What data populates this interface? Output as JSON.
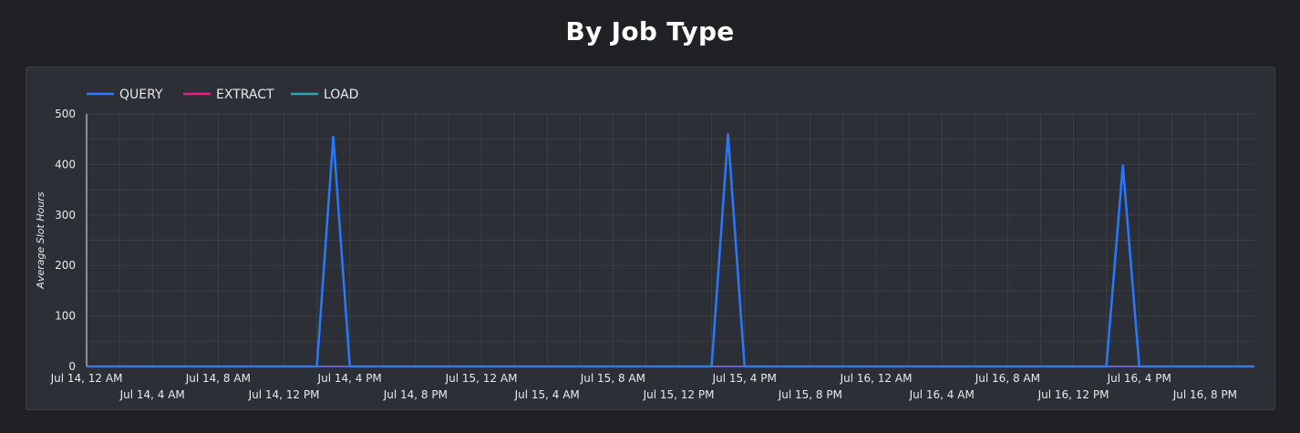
{
  "page": {
    "title": "By Job Type"
  },
  "colors": {
    "background": "#202124",
    "card": "#2d2f36",
    "grid": "#3c3f46",
    "QUERY": "#2979ff",
    "EXTRACT": "#e91e8c",
    "LOAD": "#26a7bd"
  },
  "chart_data": {
    "type": "line",
    "title": "By Job Type",
    "xlabel": "",
    "ylabel": "Average Slot Hours",
    "ylim": [
      0,
      500
    ],
    "yticks": [
      0,
      100,
      200,
      300,
      400,
      500
    ],
    "grid": true,
    "legend_position": "top-left",
    "x_unit": "hour",
    "x_start": "Jul 14, 12 AM",
    "x_end": "Jul 16, 11 PM",
    "xticks": [
      {
        "label": "Jul 14, 12 AM",
        "hour": 0
      },
      {
        "label": "Jul 14, 4 AM",
        "hour": 4
      },
      {
        "label": "Jul 14, 8 AM",
        "hour": 8
      },
      {
        "label": "Jul 14, 12 PM",
        "hour": 12
      },
      {
        "label": "Jul 14, 4 PM",
        "hour": 16
      },
      {
        "label": "Jul 14, 8 PM",
        "hour": 20
      },
      {
        "label": "Jul 15, 12 AM",
        "hour": 24
      },
      {
        "label": "Jul 15, 4 AM",
        "hour": 28
      },
      {
        "label": "Jul 15, 8 AM",
        "hour": 32
      },
      {
        "label": "Jul 15, 12 PM",
        "hour": 36
      },
      {
        "label": "Jul 15, 4 PM",
        "hour": 40
      },
      {
        "label": "Jul 15, 8 PM",
        "hour": 44
      },
      {
        "label": "Jul 16, 12 AM",
        "hour": 48
      },
      {
        "label": "Jul 16, 4 AM",
        "hour": 52
      },
      {
        "label": "Jul 16, 8 AM",
        "hour": 56
      },
      {
        "label": "Jul 16, 12 PM",
        "hour": 60
      },
      {
        "label": "Jul 16, 4 PM",
        "hour": 64
      },
      {
        "label": "Jul 16, 8 PM",
        "hour": 68
      }
    ],
    "series": [
      {
        "name": "QUERY",
        "color": "#2979ff",
        "points": [
          [
            0,
            0
          ],
          [
            14,
            0
          ],
          [
            15,
            455
          ],
          [
            16,
            0
          ],
          [
            38,
            0
          ],
          [
            39,
            460
          ],
          [
            40,
            0
          ],
          [
            62,
            0
          ],
          [
            63,
            398
          ],
          [
            64,
            0
          ],
          [
            71,
            0
          ]
        ]
      },
      {
        "name": "EXTRACT",
        "color": "#e91e8c",
        "points": [
          [
            0,
            0
          ],
          [
            71,
            0
          ]
        ]
      },
      {
        "name": "LOAD",
        "color": "#26a7bd",
        "points": [
          [
            0,
            0
          ],
          [
            71,
            0
          ]
        ]
      }
    ]
  }
}
